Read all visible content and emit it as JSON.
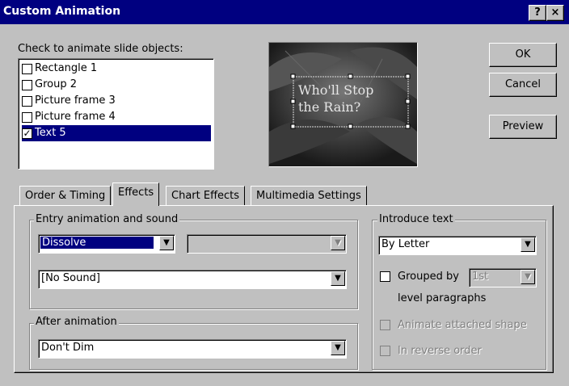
{
  "window": {
    "title": "Custom Animation",
    "help_label": "?",
    "close_label": "×"
  },
  "objects": {
    "label": "Check to animate slide objects:",
    "items": [
      {
        "label": "Rectangle 1",
        "checked": false
      },
      {
        "label": "Group 2",
        "checked": false
      },
      {
        "label": "Picture frame 3",
        "checked": false
      },
      {
        "label": "Picture frame 4",
        "checked": false
      },
      {
        "label": "Text 5",
        "checked": true
      }
    ]
  },
  "preview": {
    "text_line1": "Who'll Stop",
    "text_line2": "the Rain?"
  },
  "buttons": {
    "ok": "OK",
    "cancel": "Cancel",
    "preview": "Preview"
  },
  "tabs": [
    {
      "label": "Order & Timing",
      "active": false
    },
    {
      "label": "Effects",
      "active": true
    },
    {
      "label": "Chart Effects",
      "active": false
    },
    {
      "label": "Multimedia Settings",
      "active": false
    }
  ],
  "effects": {
    "entry_label": "Entry animation and sound",
    "effect_value": "Dissolve",
    "direction_value": "",
    "sound_value": "[No Sound]",
    "after_label": "After animation",
    "after_value": "Don't Dim"
  },
  "introduce": {
    "label": "Introduce text",
    "value": "By Letter",
    "grouped_label": "Grouped by",
    "grouped_value": "1st",
    "level_label": "level paragraphs",
    "animate_attached_label": "Animate attached shape",
    "reverse_label": "In reverse order"
  },
  "icons": {
    "dropdown": "▼",
    "check": "✓"
  }
}
